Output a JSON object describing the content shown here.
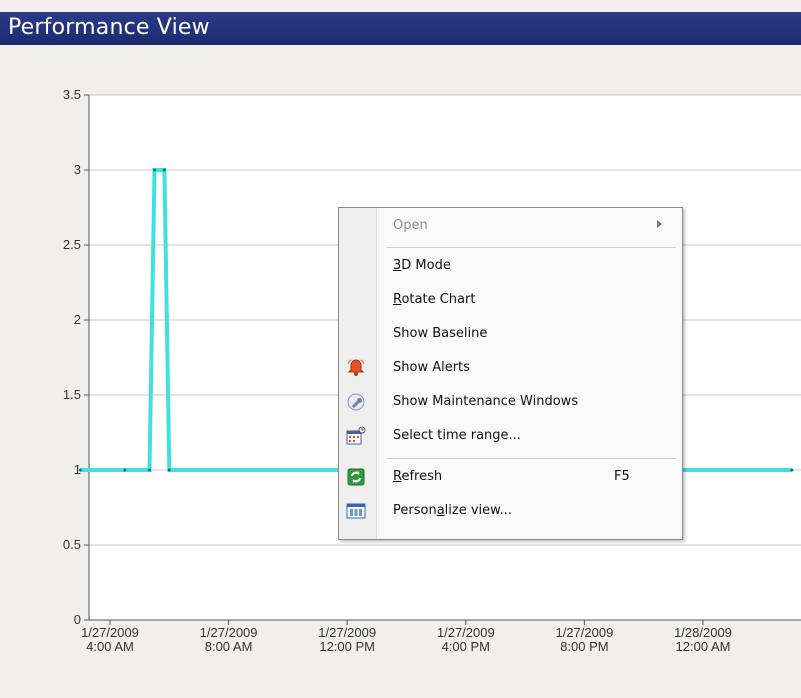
{
  "title": "Performance View",
  "chart_data": {
    "type": "line",
    "ylim": [
      0,
      3.5
    ],
    "yticks": [
      "0",
      "0.5",
      "1",
      "1.5",
      "2",
      "2.5",
      "3",
      "3.5"
    ],
    "xticks": [
      {
        "date": "1/27/2009",
        "time": "4:00 AM"
      },
      {
        "date": "1/27/2009",
        "time": "8:00 AM"
      },
      {
        "date": "1/27/2009",
        "time": "12:00 PM"
      },
      {
        "date": "1/27/2009",
        "time": "4:00 PM"
      },
      {
        "date": "1/27/2009",
        "time": "8:00 PM"
      },
      {
        "date": "1/28/2009",
        "time": "12:00 AM"
      }
    ],
    "grid": true,
    "series": [
      {
        "color": "#40e0e0",
        "x": [
          "1/27/2009 3:00 AM",
          "1/27/2009 4:30 AM",
          "1/27/2009 5:20 AM",
          "1/27/2009 5:30 AM",
          "1/27/2009 5:50 AM",
          "1/27/2009 6:00 AM",
          "1/28/2009 3:00 AM"
        ],
        "values": [
          1,
          1,
          1,
          3,
          3,
          1,
          1
        ]
      }
    ]
  },
  "context_menu": {
    "items": [
      {
        "label": "Open",
        "disabled": true,
        "submenu": true
      },
      {
        "separator": true
      },
      {
        "label_pre": "",
        "label_u": "3",
        "label_post": "D Mode"
      },
      {
        "label_pre": "",
        "label_u": "R",
        "label_post": "otate Chart"
      },
      {
        "label_pre": "Show Baseline",
        "label_u": "",
        "label_post": ""
      },
      {
        "label_pre": "Show Alerts",
        "label_u": "",
        "label_post": "",
        "icon": "alert-bell-icon"
      },
      {
        "label_pre": "Show Maintenance Windows",
        "label_u": "",
        "label_post": "",
        "icon": "wrench-icon"
      },
      {
        "label_pre": "Select time range...",
        "label_u": "",
        "label_post": "",
        "icon": "calendar-icon"
      },
      {
        "separator": true
      },
      {
        "label_pre": "",
        "label_u": "R",
        "label_post": "efresh",
        "accel": "F5",
        "icon": "refresh-icon"
      },
      {
        "label_pre": "Person",
        "label_u": "a",
        "label_post": "lize view...",
        "icon": "personalize-view-icon"
      }
    ]
  }
}
